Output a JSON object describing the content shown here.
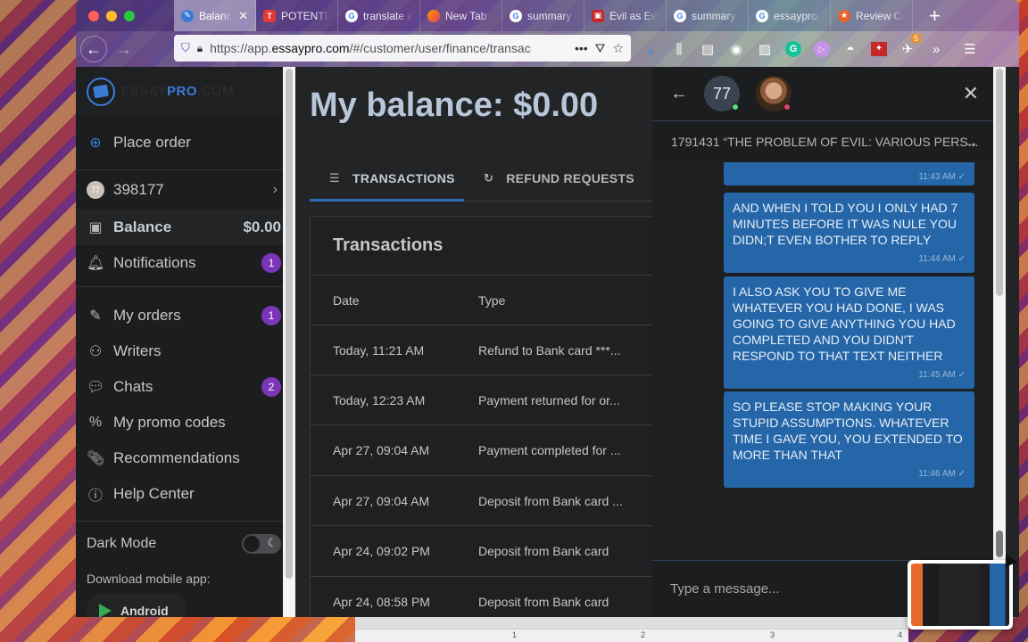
{
  "browser": {
    "tabs": [
      {
        "title": "Balance",
        "favicon": "essaypro-icon",
        "active": true
      },
      {
        "title": "POTENTIAL",
        "favicon": "t-icon",
        "active": false
      },
      {
        "title": "translate e",
        "favicon": "google-icon",
        "active": false
      },
      {
        "title": "New Tab",
        "favicon": "firefox-icon",
        "active": false
      },
      {
        "title": "summary o",
        "favicon": "google-icon",
        "active": false
      },
      {
        "title": "Evil as Evi",
        "favicon": "evil-icon",
        "active": false
      },
      {
        "title": "summary",
        "favicon": "google-icon",
        "active": false
      },
      {
        "title": "essaypro",
        "favicon": "google-icon",
        "active": false
      },
      {
        "title": "Review Co",
        "favicon": "review-icon",
        "active": false
      }
    ],
    "new_tab_label": "+",
    "url_prefix": "https://app.",
    "url_domain": "essaypro.com",
    "url_suffix": "/#/customer/user/finance/transac",
    "more_label": "•••",
    "extension_badge": "5"
  },
  "sidebar": {
    "logo": {
      "part1": "ESSAY",
      "part2": "PRO",
      "part3": ".COM"
    },
    "place_order": "Place order",
    "user": {
      "avatar_text": "77",
      "id": "398177"
    },
    "balance": {
      "label": "Balance",
      "value": "$0.00"
    },
    "notifications": {
      "label": "Notifications",
      "count": "1"
    },
    "items": [
      {
        "label": "My orders",
        "icon": "edit-icon",
        "count": "1"
      },
      {
        "label": "Writers",
        "icon": "users-icon",
        "count": ""
      },
      {
        "label": "Chats",
        "icon": "chat-icon",
        "count": "2"
      },
      {
        "label": "My promo codes",
        "icon": "percent-icon",
        "count": ""
      },
      {
        "label": "Recommendations",
        "icon": "paperclip-icon",
        "count": ""
      },
      {
        "label": "Help Center",
        "icon": "info-icon",
        "count": ""
      }
    ],
    "dark_mode_label": "Dark Mode",
    "dark_mode_on": true,
    "download_label": "Download mobile app:",
    "android_label": "Android"
  },
  "main": {
    "title": "My balance: $0.00",
    "tabs": [
      {
        "label": "TRANSACTIONS",
        "active": true
      },
      {
        "label": "REFUND REQUESTS",
        "active": false
      }
    ],
    "transactions": {
      "title": "Transactions",
      "columns": [
        "Date",
        "Type"
      ],
      "rows": [
        {
          "date": "Today, 11:21 AM",
          "type": "Refund to Bank card ***..."
        },
        {
          "date": "Today, 12:23 AM",
          "type": "Payment returned for or..."
        },
        {
          "date": "Apr 27, 09:04 AM",
          "type": "Payment completed for ..."
        },
        {
          "date": "Apr 27, 09:04 AM",
          "type": "Deposit from Bank card ..."
        },
        {
          "date": "Apr 24, 09:02 PM",
          "type": "Deposit from Bank card"
        },
        {
          "date": "Apr 24, 08:58 PM",
          "type": "Deposit from Bank card"
        }
      ]
    }
  },
  "chat": {
    "customer_avatar": "77",
    "customer_status": "online",
    "writer_status": "offline",
    "order_title": "1791431 “THE PROBLEM OF EVIL: VARIOUS PERS...",
    "messages": [
      {
        "text": "",
        "time": "11:43 AM ✓"
      },
      {
        "text": "AND WHEN I TOLD YOU I ONLY HAD 7 MINUTES BEFORE IT WAS NULE YOU DIDN;T EVEN BOTHER TO REPLY",
        "time": "11:44 AM ✓"
      },
      {
        "text": "I ALSO ASK YOU TO GIVE ME WHATEVER YOU HAD DONE, I WAS GOING TO GIVE ANYTHING YOU HAD COMPLETED AND YOU DIDN'T RESPOND TO THAT TEXT NEITHER",
        "time": "11:45 AM ✓"
      },
      {
        "text": "SO PLEASE STOP MAKING YOUR STUPID ASSUMPTIONS.  WHATEVER TIME I GAVE YOU, YOU EXTENDED TO MORE THAN THAT",
        "time": "11:46 AM ✓"
      }
    ],
    "composer_placeholder": "Type a message..."
  },
  "background_app": {
    "ruler_marks": [
      "1",
      "2",
      "3",
      "4"
    ]
  }
}
